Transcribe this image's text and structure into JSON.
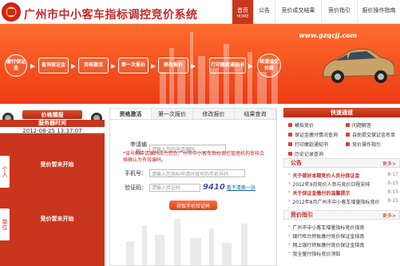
{
  "header": {
    "site_title": "广州市中小客车指标调控竞价系统",
    "nav": [
      {
        "label": "首页",
        "sub": "HOME",
        "active": true
      },
      {
        "label": "公告",
        "active": false
      },
      {
        "label": "竞价成交结果",
        "active": false
      },
      {
        "label": "竞价指引",
        "active": false
      },
      {
        "label": "报价操作指南",
        "active": false
      }
    ]
  },
  "banner": {
    "url": "www.gzqcjj.com",
    "steps": [
      "缴付保证金",
      "查询保证金",
      "资格激活",
      "第一次报价",
      "修改报价",
      "打印缴款通知书",
      "结清成交价款"
    ]
  },
  "left": {
    "tag": "价格播报",
    "time_label": "服务器时间",
    "time": "2012-08-25 13:37:07",
    "side_tab_1": "个人",
    "side_tab_2": "单位",
    "bid_status_1": "竞价暂未开始",
    "bid_status_2": "竞价暂未开始"
  },
  "center": {
    "tabs": [
      "资格激活",
      "第一次报价",
      "修改报价",
      "结果查询"
    ],
    "apply_label": "申请编码：",
    "apply_placeholder": "请输入您的申请编码",
    "note": "*该号的申请编码应为您在广州市中小客车指标调控管理机构审核合格确认为有效编码。",
    "phone_label": "手机号：",
    "phone_placeholder": "请输入您指标申请时填写的手机号码",
    "code_label": "验证码：",
    "code_placeholder": "请输入验证码",
    "captcha": "9410",
    "refresh": "看不清换一张",
    "get_code": "获取手机验证码"
  },
  "right": {
    "quick_title": "快速通道",
    "quick_links": [
      "模拟竞价",
      "保证金缴付情况查询",
      "打印缴款通知书",
      "历史记录查询",
      "问题解答",
      "自助提交保证金名单",
      "竞价操作指引"
    ],
    "notice_title": "公告",
    "more": "更多>",
    "notices": [
      {
        "text": "关于做好本期竞价人员分保证金",
        "date": "8-17",
        "hot": true
      },
      {
        "text": "2012年9月竞价人参与竞价日程安排",
        "date": "8-15",
        "hot": false
      },
      {
        "text": "关于保证金缴付的温馨提示",
        "date": "8-15",
        "hot": true
      },
      {
        "text": "2012年8月广州市中小客车增量指标竞价",
        "date": "8-15",
        "hot": false
      }
    ],
    "guide_title": "竞价指引",
    "guides": [
      "广州市中小客车增量指标竞价指南",
      "银行柜台转账缴付竞价保证金指南",
      "网上银行转账缴付竞价保证金指南",
      "我全量付指标竞价须知"
    ]
  }
}
